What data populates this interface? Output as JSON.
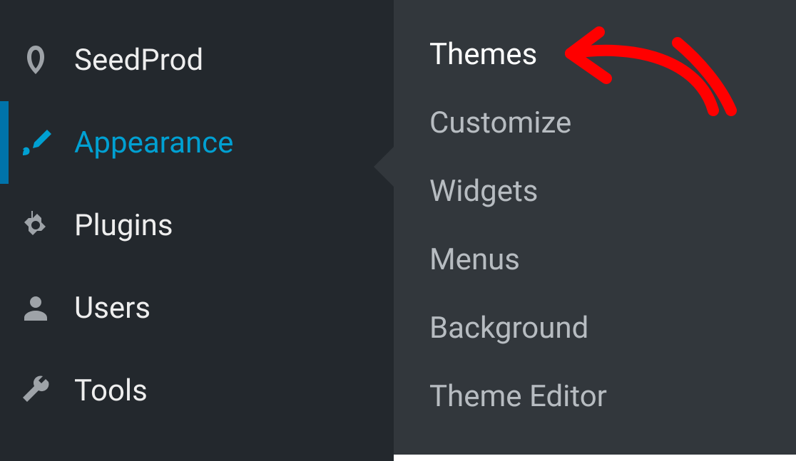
{
  "sidebar": {
    "items": [
      {
        "label": "SeedProd",
        "icon": "seedprod-icon"
      },
      {
        "label": "Appearance",
        "icon": "brush-icon",
        "active": true
      },
      {
        "label": "Plugins",
        "icon": "plug-icon"
      },
      {
        "label": "Users",
        "icon": "user-icon"
      },
      {
        "label": "Tools",
        "icon": "wrench-icon"
      }
    ]
  },
  "submenu": {
    "items": [
      {
        "label": "Themes",
        "highlight": true,
        "annotated": true
      },
      {
        "label": "Customize"
      },
      {
        "label": "Widgets"
      },
      {
        "label": "Menus"
      },
      {
        "label": "Background"
      },
      {
        "label": "Theme Editor"
      }
    ]
  }
}
